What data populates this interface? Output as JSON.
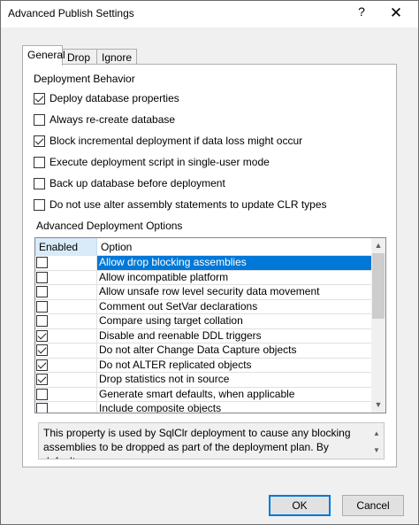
{
  "window": {
    "title": "Advanced Publish Settings",
    "help_label": "?",
    "close_label": "✕"
  },
  "tabs": [
    {
      "label": "General",
      "active": true
    },
    {
      "label": "Drop",
      "active": false
    },
    {
      "label": "Ignore",
      "active": false
    }
  ],
  "general": {
    "section_title": "Deployment Behavior",
    "options": [
      {
        "label": "Deploy database properties",
        "checked": true
      },
      {
        "label": "Always re-create database",
        "checked": false
      },
      {
        "label": "Block incremental deployment if data loss might occur",
        "checked": true
      },
      {
        "label": "Execute deployment script in single-user mode",
        "checked": false
      },
      {
        "label": "Back up database before deployment",
        "checked": false
      },
      {
        "label": "Do not use alter assembly statements to update CLR types",
        "checked": false
      }
    ],
    "advanced_title": "Advanced Deployment Options",
    "grid": {
      "columns": [
        "Enabled",
        "Option"
      ],
      "rows": [
        {
          "enabled": false,
          "option": "Allow drop blocking assemblies",
          "selected": true
        },
        {
          "enabled": false,
          "option": "Allow incompatible platform",
          "selected": false
        },
        {
          "enabled": false,
          "option": "Allow unsafe row level security data movement",
          "selected": false
        },
        {
          "enabled": false,
          "option": "Comment out SetVar declarations",
          "selected": false
        },
        {
          "enabled": false,
          "option": "Compare using target collation",
          "selected": false
        },
        {
          "enabled": true,
          "option": "Disable and reenable DDL triggers",
          "selected": false
        },
        {
          "enabled": true,
          "option": "Do not alter Change Data Capture objects",
          "selected": false
        },
        {
          "enabled": true,
          "option": "Do not ALTER replicated objects",
          "selected": false
        },
        {
          "enabled": true,
          "option": "Drop statistics not in source",
          "selected": false
        },
        {
          "enabled": false,
          "option": "Generate smart defaults, when applicable",
          "selected": false
        },
        {
          "enabled": false,
          "option": "Include composite objects",
          "selected": false
        }
      ]
    },
    "description": "This property is used by SqlClr deployment to cause any blocking assemblies to be dropped as part of the deployment plan. By default,"
  },
  "buttons": {
    "ok_label": "OK",
    "cancel_label": "Cancel"
  },
  "colors": {
    "selection": "#0078d7",
    "header_highlight": "#d9ebf9"
  }
}
